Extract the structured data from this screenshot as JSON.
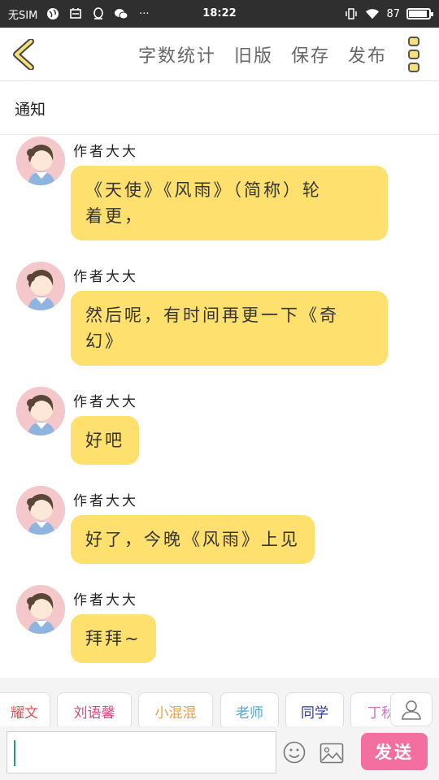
{
  "status_bar": {
    "carrier": "无SIM",
    "time": "18:22",
    "battery": "87"
  },
  "toolbar": {
    "word_count": "字数统计",
    "old_version": "旧版",
    "save": "保存",
    "publish": "发布"
  },
  "notice": "通知",
  "messages": [
    {
      "author": "作者大大",
      "text": "《天使》《风雨》（简称）轮着更，",
      "lines": [
        "《天使》《风雨》（简称）轮",
        "着更，"
      ]
    },
    {
      "author": "作者大大",
      "text": "然后呢，有时间再更一下《奇幻》",
      "lines": [
        "然后呢，有时间再更一下《奇",
        "幻》"
      ]
    },
    {
      "author": "作者大大",
      "text": "好吧",
      "lines": [
        "好吧"
      ]
    },
    {
      "author": "作者大大",
      "text": "好了，今晚《风雨》上见",
      "lines": [
        "好了，今晚《风雨》上见"
      ]
    },
    {
      "author": "作者大大",
      "text": "拜拜~",
      "lines": [
        "拜拜~"
      ]
    }
  ],
  "chips": [
    {
      "label": "耀文",
      "color": "#e0525a"
    },
    {
      "label": "刘语馨",
      "color": "#e0427e"
    },
    {
      "label": "小混混",
      "color": "#e8a040"
    },
    {
      "label": "老师",
      "color": "#4aa8d8"
    },
    {
      "label": "同学",
      "color": "#2a3a9a"
    },
    {
      "label": "丁秋",
      "color": "#d76ad6"
    }
  ],
  "input": {
    "placeholder": ""
  },
  "send_label": "发送",
  "colors": {
    "bubble": "#fee06f",
    "send": "#f36fa0",
    "accent": "#f6e07a"
  },
  "icons": [
    "back-icon",
    "more-icon",
    "emoji-icon",
    "image-icon",
    "person-icon"
  ]
}
